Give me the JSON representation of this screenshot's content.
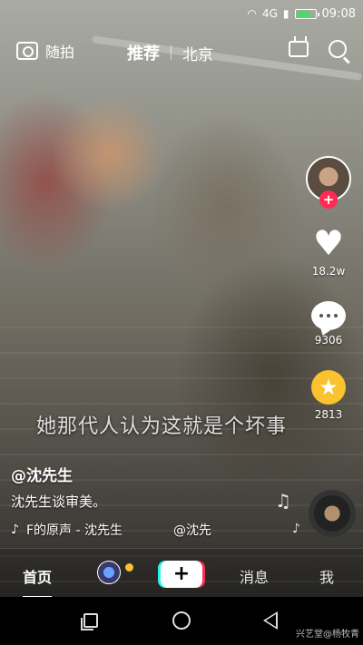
{
  "status_bar": {
    "network": "4G",
    "time": "09:08"
  },
  "top_nav": {
    "camera_label": "随拍",
    "tabs": [
      {
        "label": "推荐",
        "active": true
      },
      {
        "label": "北京",
        "active": false
      }
    ],
    "icons": [
      "camera-icon",
      "tv-icon",
      "search-icon"
    ]
  },
  "right_rail": {
    "likes": "18.2w",
    "comments": "9306",
    "favorites": "2813",
    "follow_symbol": "+"
  },
  "subtitle": "她那代人认为这就是个坏事",
  "post": {
    "username": "@沈先生",
    "caption": "沈先生谈审美。",
    "music_text": "F的原声 - 沈先生",
    "music_mention": "@沈先"
  },
  "tab_bar": {
    "home": "首页",
    "create": "+",
    "messages": "消息",
    "me": "我"
  },
  "watermark": "兴艺堂@杨牧青",
  "colors": {
    "accent_red": "#fe2c55",
    "accent_cyan": "#25f4ee",
    "star_yellow": "#f9c22e"
  }
}
